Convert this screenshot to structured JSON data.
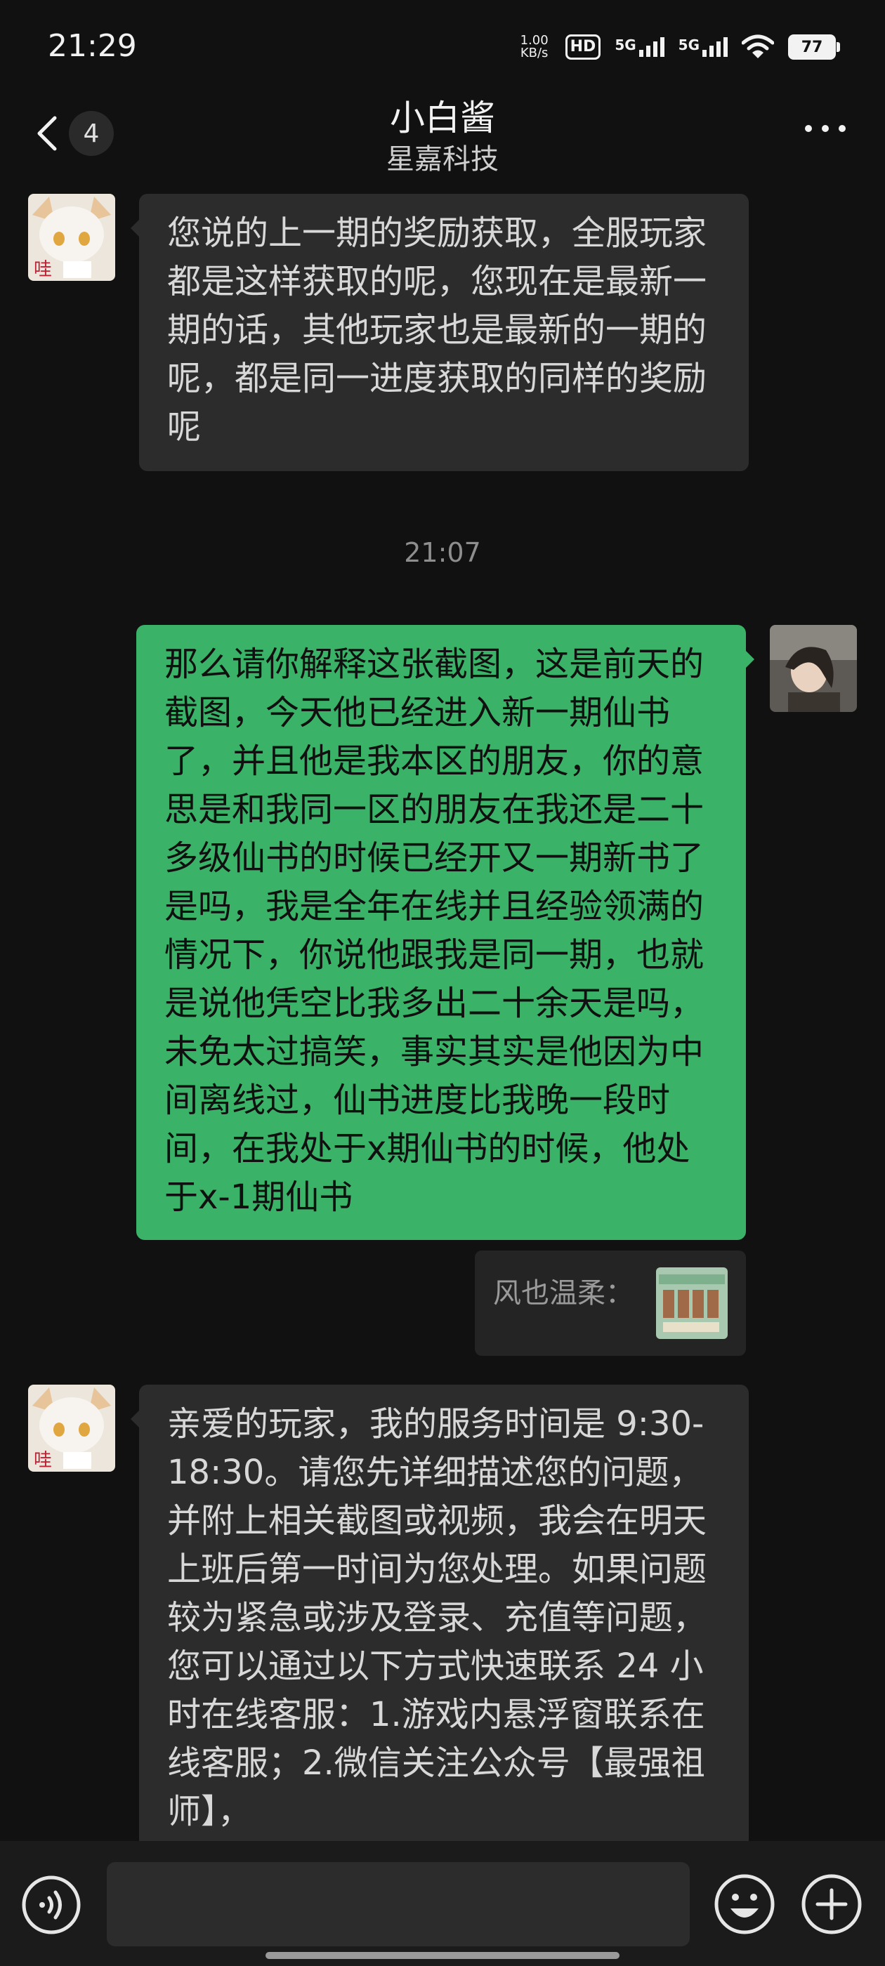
{
  "status_bar": {
    "time": "21:29",
    "net_speed_value": "1.00",
    "net_speed_unit": "KB/s",
    "hd_badge": "HD",
    "sim1": "5G",
    "sim2": "5G",
    "battery": "77"
  },
  "header": {
    "unread_count": "4",
    "title": "小白酱",
    "subtitle": "星嘉科技"
  },
  "messages": [
    {
      "side": "incoming",
      "text": "您说的上一期的奖励获取，全服玩家都是这样获取的呢，您现在是最新一期的话，其他玩家也是最新的一期的呢，都是同一进度获取的同样的奖励呢"
    },
    {
      "timestamp": "21:07"
    },
    {
      "side": "outgoing",
      "text": "那么请你解释这张截图，这是前天的截图，今天他已经进入新一期仙书了，并且他是我本区的朋友，你的意思是和我同一区的朋友在我还是二十多级仙书的时候已经开又一期新书了是吗，我是全年在线并且经验领满的情况下，你说他跟我是同一期，也就是说他凭空比我多出二十余天是吗，未免太过搞笑，事实其实是他因为中间离线过，仙书进度比我晚一段时间，在我处于x期仙书的时候，他处于x-1期仙书"
    },
    {
      "quote_label": "风也温柔："
    },
    {
      "side": "incoming",
      "text": "亲爱的玩家，我的服务时间是 9:30-18:30。请您先详细描述您的问题，并附上相关截图或视频，我会在明天上班后第一时间为您处理。如果问题较为紧急或涉及登录、充值等问题，您可以通过以下方式快速联系 24 小时在线客服：1.游戏内悬浮窗联系在线客服；2.微信关注公众号【最强祖师】，"
    }
  ],
  "colors": {
    "background": "#111111",
    "incoming_bubble": "#2c2c2c",
    "outgoing_bubble": "#3ab267"
  },
  "icons": [
    "back-arrow-icon",
    "more-dots-icon",
    "voice-icon",
    "emoji-icon",
    "plus-icon"
  ]
}
